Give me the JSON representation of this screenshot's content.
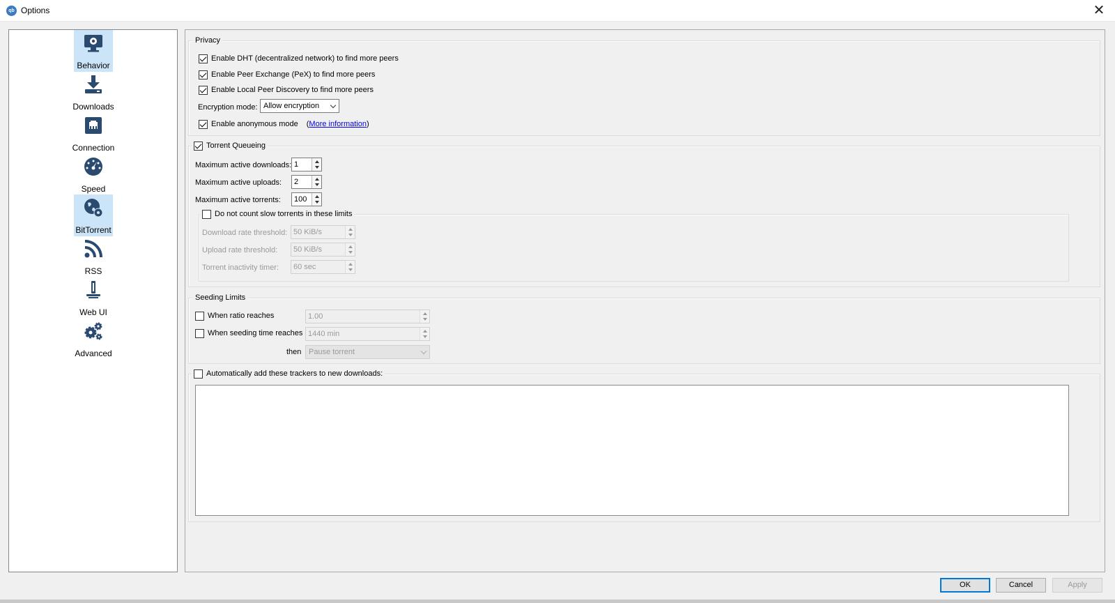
{
  "window": {
    "title": "Options",
    "app_icon_text": "qb",
    "close_glyph": "✕"
  },
  "sidebar": {
    "items": [
      {
        "label": "Behavior",
        "icon": "monitor-gear-icon",
        "selected": false,
        "hover": true
      },
      {
        "label": "Downloads",
        "icon": "download-icon",
        "selected": false
      },
      {
        "label": "Connection",
        "icon": "network-port-icon",
        "selected": false
      },
      {
        "label": "Speed",
        "icon": "speedometer-icon",
        "selected": false
      },
      {
        "label": "BitTorrent",
        "icon": "globe-gear-icon",
        "selected": true
      },
      {
        "label": "RSS",
        "icon": "rss-icon",
        "selected": false
      },
      {
        "label": "Web UI",
        "icon": "web-ui-icon",
        "selected": false
      },
      {
        "label": "Advanced",
        "icon": "gears-icon",
        "selected": false
      }
    ]
  },
  "privacy": {
    "title": "Privacy",
    "dht": {
      "label": "Enable DHT (decentralized network) to find more peers",
      "checked": true
    },
    "pex": {
      "label": "Enable Peer Exchange (PeX) to find more peers",
      "checked": true
    },
    "lsd": {
      "label": "Enable Local Peer Discovery to find more peers",
      "checked": true
    },
    "encryption_label": "Encryption mode:",
    "encryption_value": "Allow encryption",
    "anon": {
      "label": "Enable anonymous mode",
      "checked": true
    },
    "more_info_open": "(",
    "more_info_link": "More information",
    "more_info_close": ")"
  },
  "queueing": {
    "title": "Torrent Queueing",
    "checked": true,
    "max_downloads_label": "Maximum active downloads:",
    "max_downloads_value": "1",
    "max_uploads_label": "Maximum active uploads:",
    "max_uploads_value": "2",
    "max_torrents_label": "Maximum active torrents:",
    "max_torrents_value": "100",
    "slow": {
      "title": "Do not count slow torrents in these limits",
      "checked": false,
      "download_label": "Download rate threshold:",
      "download_value": "50 KiB/s",
      "upload_label": "Upload rate threshold:",
      "upload_value": "50 KiB/s",
      "inactivity_label": "Torrent inactivity timer:",
      "inactivity_value": "60 sec"
    }
  },
  "seeding": {
    "title": "Seeding Limits",
    "ratio": {
      "label": "When ratio reaches",
      "checked": false,
      "value": "1.00"
    },
    "time": {
      "label": "When seeding time reaches",
      "checked": false,
      "value": "1440 min"
    },
    "then_label": "then",
    "then_value": "Pause torrent"
  },
  "trackers": {
    "title": "Automatically add these trackers to new downloads:",
    "checked": false,
    "text": ""
  },
  "buttons": {
    "ok": "OK",
    "cancel": "Cancel",
    "apply": "Apply"
  }
}
